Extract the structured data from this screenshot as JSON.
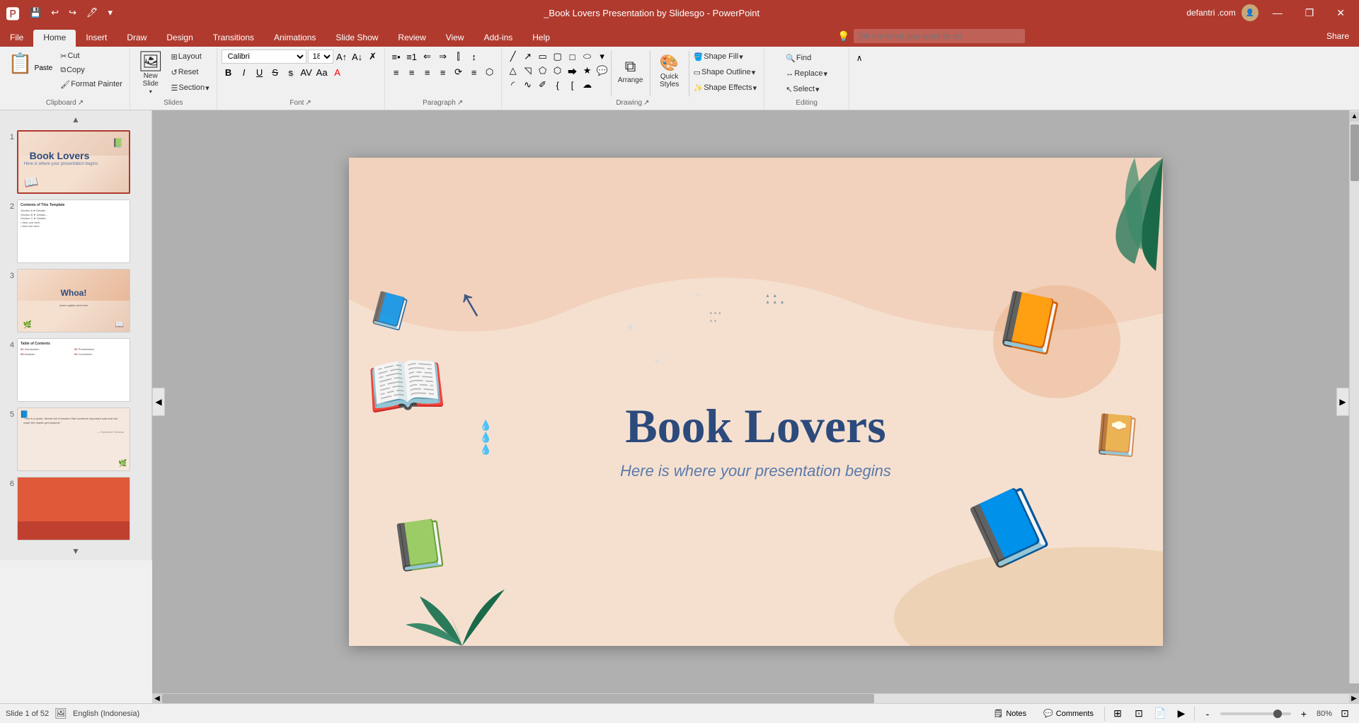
{
  "app": {
    "title": "_Book Lovers Presentation by Slidesgo - PowerPoint",
    "user": "defantri .com",
    "minimize": "—",
    "restore": "❐",
    "close": "✕"
  },
  "qat": {
    "save": "💾",
    "undo": "↩",
    "redo": "↪",
    "customize": "🖊",
    "dropdown": "▾"
  },
  "tabs": [
    {
      "label": "File",
      "active": false
    },
    {
      "label": "Home",
      "active": true
    },
    {
      "label": "Insert",
      "active": false
    },
    {
      "label": "Draw",
      "active": false
    },
    {
      "label": "Design",
      "active": false
    },
    {
      "label": "Transitions",
      "active": false
    },
    {
      "label": "Animations",
      "active": false
    },
    {
      "label": "Slide Show",
      "active": false
    },
    {
      "label": "Review",
      "active": false
    },
    {
      "label": "View",
      "active": false
    },
    {
      "label": "Add-ins",
      "active": false
    },
    {
      "label": "Help",
      "active": false
    }
  ],
  "tell_me": {
    "placeholder": "Tell me what you want to do",
    "icon": "💡"
  },
  "share_label": "Share",
  "ribbon": {
    "clipboard": {
      "label": "Clipboard",
      "paste_label": "Paste",
      "cut_label": "Cut",
      "copy_label": "Copy",
      "format_painter_label": "Format Painter"
    },
    "slides": {
      "label": "Slides",
      "new_slide_label": "New\nSlide",
      "layout_label": "Layout",
      "reset_label": "Reset",
      "section_label": "Section"
    },
    "font": {
      "label": "Font",
      "font_name": "Calibri",
      "font_size": "18",
      "bold": "B",
      "italic": "I",
      "underline": "U",
      "strikethrough": "S",
      "shadow": "s",
      "char_spacing_label": "AV",
      "change_case_label": "Aa",
      "font_color_label": "A",
      "clear_label": "✗",
      "highlight_label": "▲"
    },
    "paragraph": {
      "label": "Paragraph",
      "bullets_label": "≡",
      "numbering_label": "≡#",
      "decrease_indent": "⇐",
      "increase_indent": "⇒",
      "line_spacing_label": "↕",
      "align_left": "≡",
      "align_center": "≡",
      "align_right": "≡",
      "justify": "≡",
      "columns_label": "⫿",
      "text_direction_label": "⟳",
      "align_text_label": "≡"
    },
    "drawing": {
      "label": "Drawing",
      "arrange_label": "Arrange",
      "quick_styles_label": "Quick\nStyles",
      "shape_fill_label": "Shape Fill",
      "shape_outline_label": "Shape Outline",
      "shape_effects_label": "Shape Effects"
    },
    "editing": {
      "label": "Editing",
      "find_label": "Find",
      "replace_label": "Replace",
      "select_label": "Select"
    }
  },
  "slide": {
    "title": "Book Lovers",
    "subtitle": "Here is where your presentation begins"
  },
  "slides": [
    {
      "num": 1,
      "active": true
    },
    {
      "num": 2,
      "active": false
    },
    {
      "num": 3,
      "active": false
    },
    {
      "num": 4,
      "active": false
    },
    {
      "num": 5,
      "active": false
    },
    {
      "num": 6,
      "active": false
    }
  ],
  "status": {
    "slide_info": "Slide 1 of 52",
    "language": "English (Indonesia)",
    "notes_label": "Notes",
    "comments_label": "Comments",
    "zoom": "80%"
  },
  "colors": {
    "accent": "#b03a2e",
    "slide_bg": "#f5e0d0",
    "title_color": "#2c4a7c",
    "subtitle_color": "#5a7aaa",
    "book_blue": "#2e6da4",
    "book_dark": "#1a4a7a"
  }
}
